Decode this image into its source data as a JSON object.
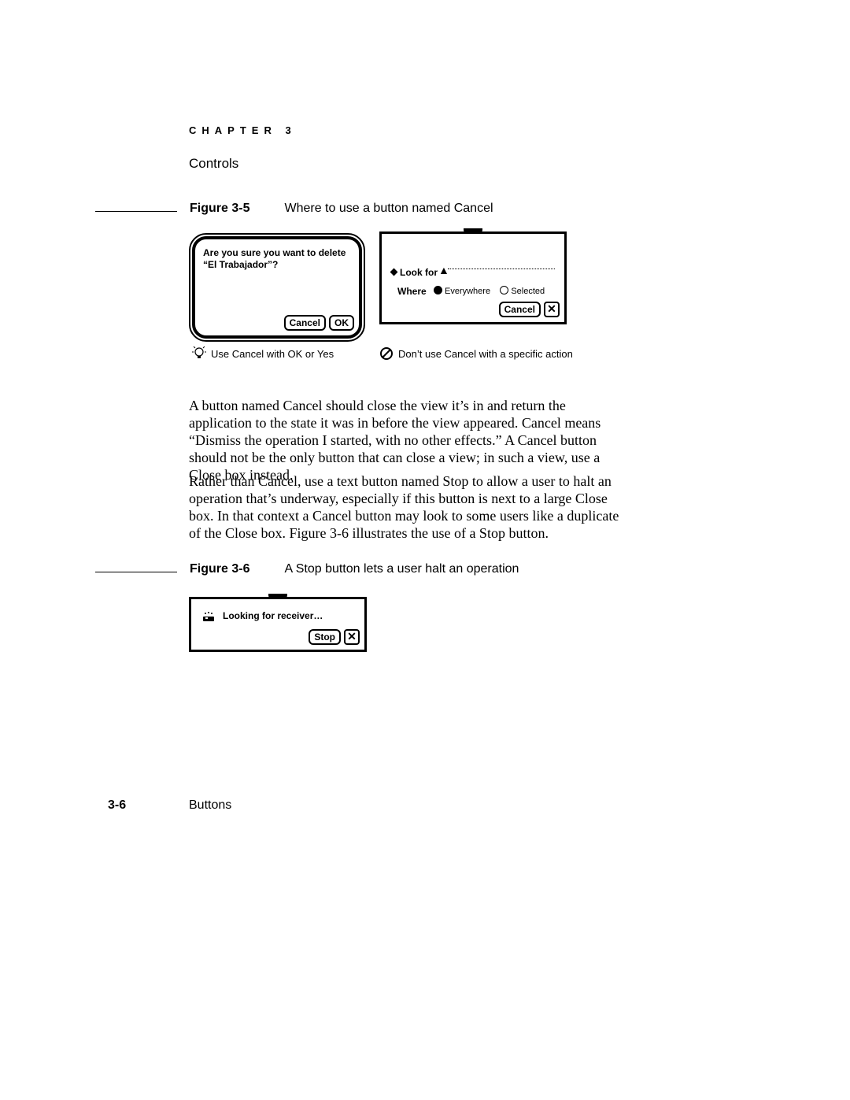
{
  "chapter_eyebrow": "CHAPTER 3",
  "section_title": "Controls",
  "figure35": {
    "number": "Figure 3-5",
    "title": "Where to use a button named Cancel",
    "bubble_prompt": "Are you sure you want to delete “El Trabajador”?",
    "bubble_cancel": "Cancel",
    "bubble_ok": "OK",
    "lookfor_label": "Look for",
    "where_label": "Where",
    "radio_everywhere": "Everywhere",
    "radio_selected": "Selected",
    "lookfor_cancel": "Cancel",
    "hint_ok": "Use Cancel with OK or Yes",
    "hint_bad": "Don’t use Cancel with a specific action"
  },
  "para1": "A button named Cancel should close the view it’s in and return the application to the state it was in before the view appeared. Cancel means “Dismiss the operation I started, with no other effects.” A Cancel button should not be the only button that can close a view; in such a view, use a Close box instead.",
  "para2": "Rather than Cancel, use a text button named Stop to allow a user to halt an operation that’s underway, especially if this button is next to a large Close box. In that context a Cancel button may look to some users like a duplicate of the Close box. Figure 3-6 illustrates the use of a Stop button.",
  "figure36": {
    "number": "Figure 3-6",
    "title": "A Stop button lets a user halt an operation",
    "status_text": "Looking for receiver…",
    "stop_label": "Stop"
  },
  "page_number": "3-6",
  "footer_section": "Buttons"
}
